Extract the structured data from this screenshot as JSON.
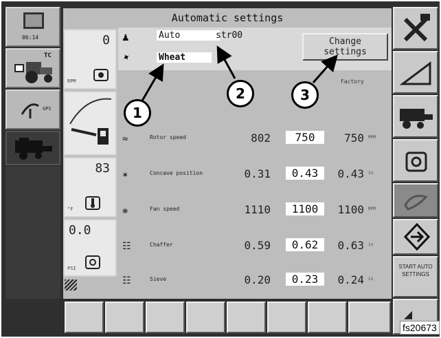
{
  "header": {
    "title": "Automatic settings"
  },
  "clock": {
    "time": "06:14"
  },
  "left_buttons": {
    "tc_label": "TC",
    "gps_label": "GPS"
  },
  "gauges": {
    "rpm": {
      "value": "0",
      "unit": "RPM"
    },
    "temp": {
      "value": "83",
      "unit": "°F"
    },
    "pressure": {
      "value": "0.0",
      "unit": "PSI"
    }
  },
  "crop": {
    "mode": "Auto",
    "profile": "str00",
    "crop_name": "Wheat"
  },
  "change_settings": {
    "line1": "Change",
    "line2": "settings"
  },
  "columns": {
    "factory": "Factory"
  },
  "rows": [
    {
      "label": "Rotor speed",
      "current": "802",
      "setpoint": "750",
      "factory": "750",
      "unit": "RPM"
    },
    {
      "label": "Concave position",
      "current": "0.31",
      "setpoint": "0.43",
      "factory": "0.43",
      "unit": "in"
    },
    {
      "label": "Fan speed",
      "current": "1110",
      "setpoint": "1100",
      "factory": "1100",
      "unit": "RPM"
    },
    {
      "label": "Chaffer",
      "current": "0.59",
      "setpoint": "0.62",
      "factory": "0.63",
      "unit": "in"
    },
    {
      "label": "Sieve",
      "current": "0.20",
      "setpoint": "0.23",
      "factory": "0.24",
      "unit": "in"
    }
  ],
  "right_buttons": {
    "start_auto": "START AUTO SETTINGS"
  },
  "callouts": [
    "1",
    "2",
    "3"
  ],
  "figure_ref": "fs20673",
  "icons": [
    "monitor-icon",
    "tractor-icon",
    "gps-antenna-icon",
    "combine-icon",
    "hammer-wrench-icon",
    "ramp-icon",
    "fuel-gauge-icon",
    "engine-icon",
    "thermometer-icon",
    "pressure-icon",
    "hand-icon",
    "diamond-arrow-icon"
  ]
}
